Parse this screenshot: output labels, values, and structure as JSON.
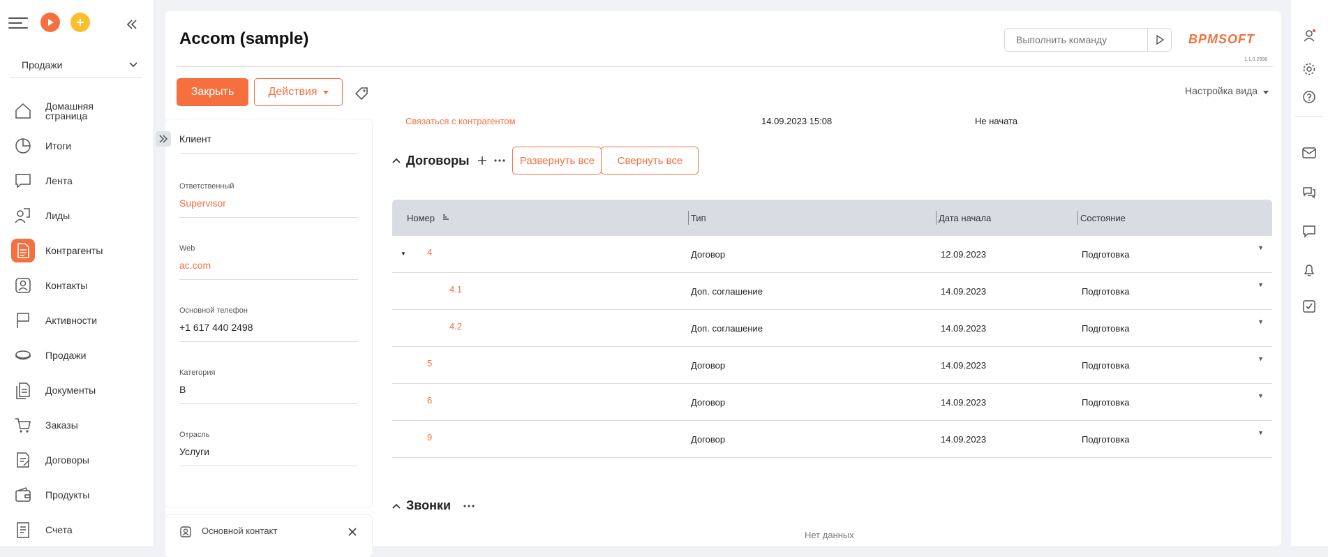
{
  "nav": {
    "workspace": "Продажи",
    "items": [
      {
        "label": "Домашняя страница",
        "icon": "home-icon"
      },
      {
        "label": "Итоги",
        "icon": "pie-chart-icon"
      },
      {
        "label": "Лента",
        "icon": "chat-icon"
      },
      {
        "label": "Лиды",
        "icon": "lead-icon"
      },
      {
        "label": "Контрагенты",
        "icon": "account-icon"
      },
      {
        "label": "Контакты",
        "icon": "contact-icon"
      },
      {
        "label": "Активности",
        "icon": "flag-icon"
      },
      {
        "label": "Продажи",
        "icon": "coins-icon"
      },
      {
        "label": "Документы",
        "icon": "documents-icon"
      },
      {
        "label": "Заказы",
        "icon": "cart-icon"
      },
      {
        "label": "Договоры",
        "icon": "contract-icon"
      },
      {
        "label": "Продукты",
        "icon": "wallet-icon"
      },
      {
        "label": "Счета",
        "icon": "invoice-icon"
      }
    ],
    "active_index": 4
  },
  "header": {
    "title": "Accom (sample)",
    "command_placeholder": "Выполнить команду",
    "logo": "BPMSOFT",
    "version": "1.1.0.2998",
    "close_label": "Закрыть",
    "actions_label": "Действия",
    "view_settings": "Настройка вида"
  },
  "profile": {
    "type_value": "Клиент",
    "owner_label": "Ответственный",
    "owner_value": "Supervisor",
    "web_label": "Web",
    "web_value": "ac.com",
    "phone_label": "Основной телефон",
    "phone_value": "+1 617 440 2498",
    "category_label": "Категория",
    "category_value": "B",
    "industry_label": "Отрасль",
    "industry_value": "Услуги",
    "contact_panel_label": "Основной контакт"
  },
  "activity": {
    "title": "Связаться с контрагентом",
    "date": "14.09.2023 15:08",
    "status": "Не начата"
  },
  "contracts": {
    "title": "Договоры",
    "expand_all": "Развернуть все",
    "collapse_all": "Свернуть все",
    "columns": [
      "Номер",
      "Тип",
      "Дата начала",
      "Состояние"
    ],
    "rows": [
      {
        "number": "4",
        "type": "Договор",
        "date": "12.09.2023",
        "state": "Подготовка",
        "level": 0,
        "expanded": true
      },
      {
        "number": "4.1",
        "type": "Доп. соглашение",
        "date": "14.09.2023",
        "state": "Подготовка",
        "level": 1
      },
      {
        "number": "4.2",
        "type": "Доп. соглашение",
        "date": "14.09.2023",
        "state": "Подготовка",
        "level": 1
      },
      {
        "number": "5",
        "type": "Договор",
        "date": "14.09.2023",
        "state": "Подготовка",
        "level": 0
      },
      {
        "number": "6",
        "type": "Договор",
        "date": "14.09.2023",
        "state": "Подготовка",
        "level": 0
      },
      {
        "number": "9",
        "type": "Договор",
        "date": "14.09.2023",
        "state": "Подготовка",
        "level": 0
      }
    ]
  },
  "calls": {
    "title": "Звонки",
    "empty": "Нет данных"
  },
  "colors": {
    "accent": "#f6703f"
  }
}
